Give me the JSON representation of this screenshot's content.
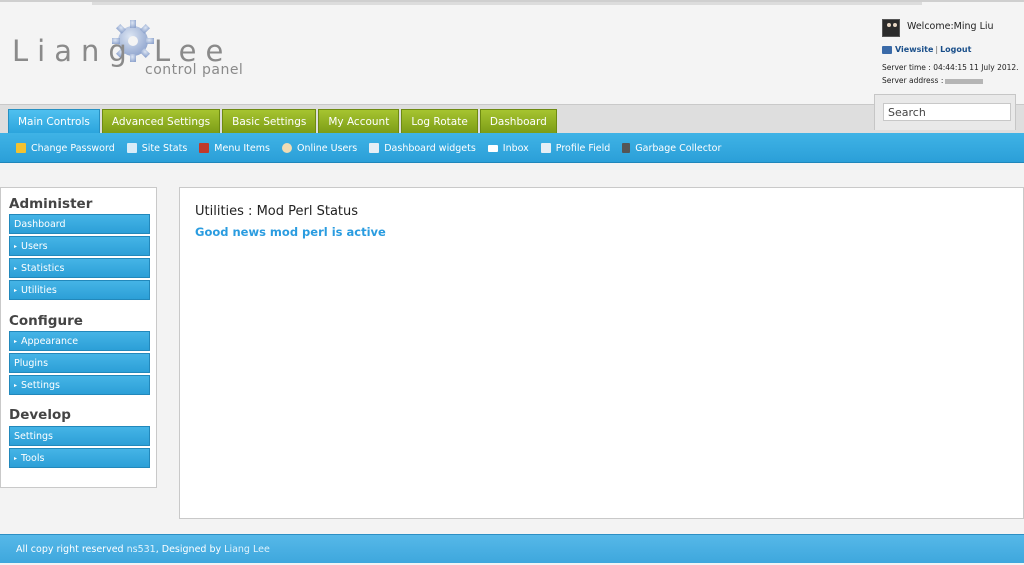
{
  "logo": {
    "title": "Liang Lee",
    "subtitle": "control panel"
  },
  "user": {
    "welcome": "Welcome:Ming Liu",
    "viewsite": "Viewsite",
    "separator": "|",
    "logout": "Logout",
    "server_time": "Server time : 04:44:15 11 July 2012.",
    "server_address_label": "Server address :"
  },
  "tabs": [
    {
      "label": "Main Controls"
    },
    {
      "label": "Advanced Settings"
    },
    {
      "label": "Basic Settings"
    },
    {
      "label": "My Account"
    },
    {
      "label": "Log Rotate"
    },
    {
      "label": "Dashboard"
    }
  ],
  "search": {
    "placeholder": "Search"
  },
  "subnav": [
    {
      "label": "Change Password",
      "icon": "lock-icon",
      "color": "#f2c230"
    },
    {
      "label": "Site Stats",
      "icon": "monitor-icon",
      "color": "#d8ecf8"
    },
    {
      "label": "Menu Items",
      "icon": "menu-icon",
      "color": "#c0392b"
    },
    {
      "label": "Online Users",
      "icon": "user-icon",
      "color": "#f0dcb4"
    },
    {
      "label": "Dashboard widgets",
      "icon": "widget-icon",
      "color": "#e6eef5"
    },
    {
      "label": "Inbox",
      "icon": "mail-icon",
      "color": "#ffffff"
    },
    {
      "label": "Profile Field",
      "icon": "list-icon",
      "color": "#e6eef5"
    },
    {
      "label": "Garbage Collector",
      "icon": "trash-icon",
      "color": "#555555"
    }
  ],
  "sidebar": {
    "administer": {
      "heading": "Administer",
      "items": [
        {
          "label": "Dashboard",
          "arrow": ""
        },
        {
          "label": "Users",
          "arrow": "▸"
        },
        {
          "label": "Statistics",
          "arrow": "▸"
        },
        {
          "label": "Utilities",
          "arrow": "▸"
        }
      ]
    },
    "configure": {
      "heading": "Configure",
      "items": [
        {
          "label": "Appearance",
          "arrow": "▸"
        },
        {
          "label": "Plugins",
          "arrow": ""
        },
        {
          "label": "Settings",
          "arrow": "▸"
        }
      ]
    },
    "develop": {
      "heading": "Develop",
      "items": [
        {
          "label": "Settings",
          "arrow": ""
        },
        {
          "label": "Tools",
          "arrow": "▸"
        }
      ]
    }
  },
  "main": {
    "title": "Utilities : Mod Perl Status",
    "message": "Good news mod perl is active"
  },
  "footer": {
    "prefix": "All copy right reserved",
    "site": "ns531",
    "middle": ", Designed by",
    "author": "Liang Lee"
  },
  "colors": {
    "accent": "#2aa3dc",
    "tab_green": "#8fb024",
    "message": "#2a9ce0"
  }
}
